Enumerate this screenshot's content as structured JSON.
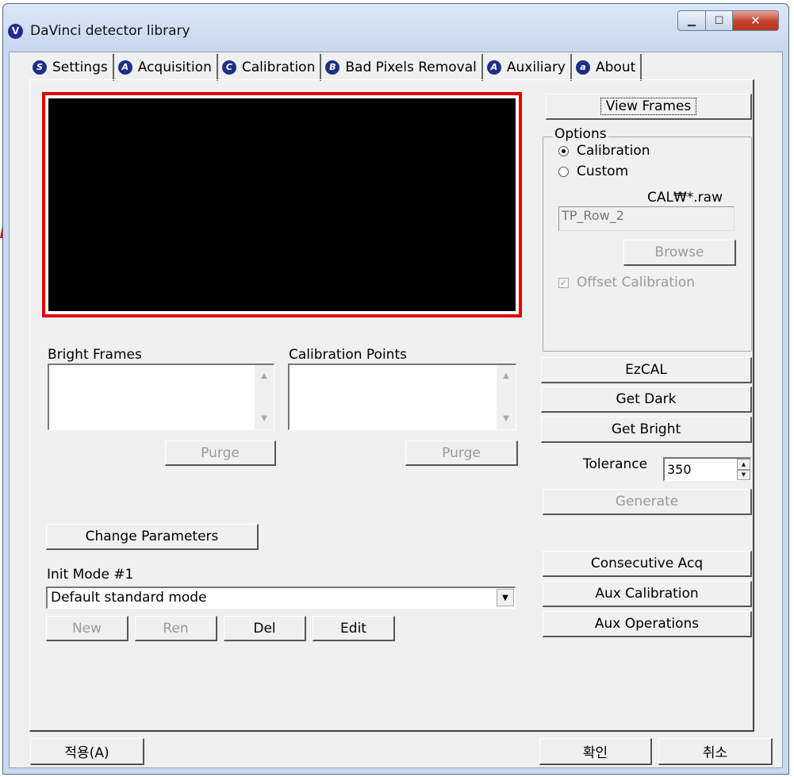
{
  "window": {
    "title": "DaVinci detector library",
    "app_icon_letter": "V"
  },
  "tabs": [
    {
      "badge": "S",
      "label": "Settings"
    },
    {
      "badge": "A",
      "label": "Acquisition"
    },
    {
      "badge": "C",
      "label": "Calibration"
    },
    {
      "badge": "B",
      "label": "Bad Pixels Removal"
    },
    {
      "badge": "A",
      "label": "Auxiliary"
    },
    {
      "badge": "a",
      "label": "About"
    }
  ],
  "frames": {
    "bright_frames_label": "Bright Frames",
    "calibration_points_label": "Calibration Points",
    "purge_label": "Purge"
  },
  "change_parameters_label": "Change Parameters",
  "init_mode": {
    "label": "Init Mode #1",
    "selected": "Default standard mode",
    "new_label": "New",
    "ren_label": "Ren",
    "del_label": "Del",
    "edit_label": "Edit"
  },
  "right": {
    "view_frames": "View Frames",
    "options_label": "Options",
    "radio_calibration": "Calibration",
    "radio_custom": "Custom",
    "path_hint": "CAL₩*.raw",
    "custom_value": "TP_Row_2",
    "browse": "Browse",
    "offset_calibration": "Offset Calibration",
    "ezcal": "EzCAL",
    "get_dark": "Get Dark",
    "get_bright": "Get Bright",
    "tolerance_label": "Tolerance",
    "tolerance_value": "350",
    "generate": "Generate",
    "consecutive_acq": "Consecutive Acq",
    "aux_calibration": "Aux Calibration",
    "aux_operations": "Aux Operations"
  },
  "footer": {
    "apply": "적용(A)",
    "ok": "확인",
    "cancel": "취소"
  },
  "colors": {
    "highlight_border": "#e60000",
    "preview_bg": "#000000"
  }
}
